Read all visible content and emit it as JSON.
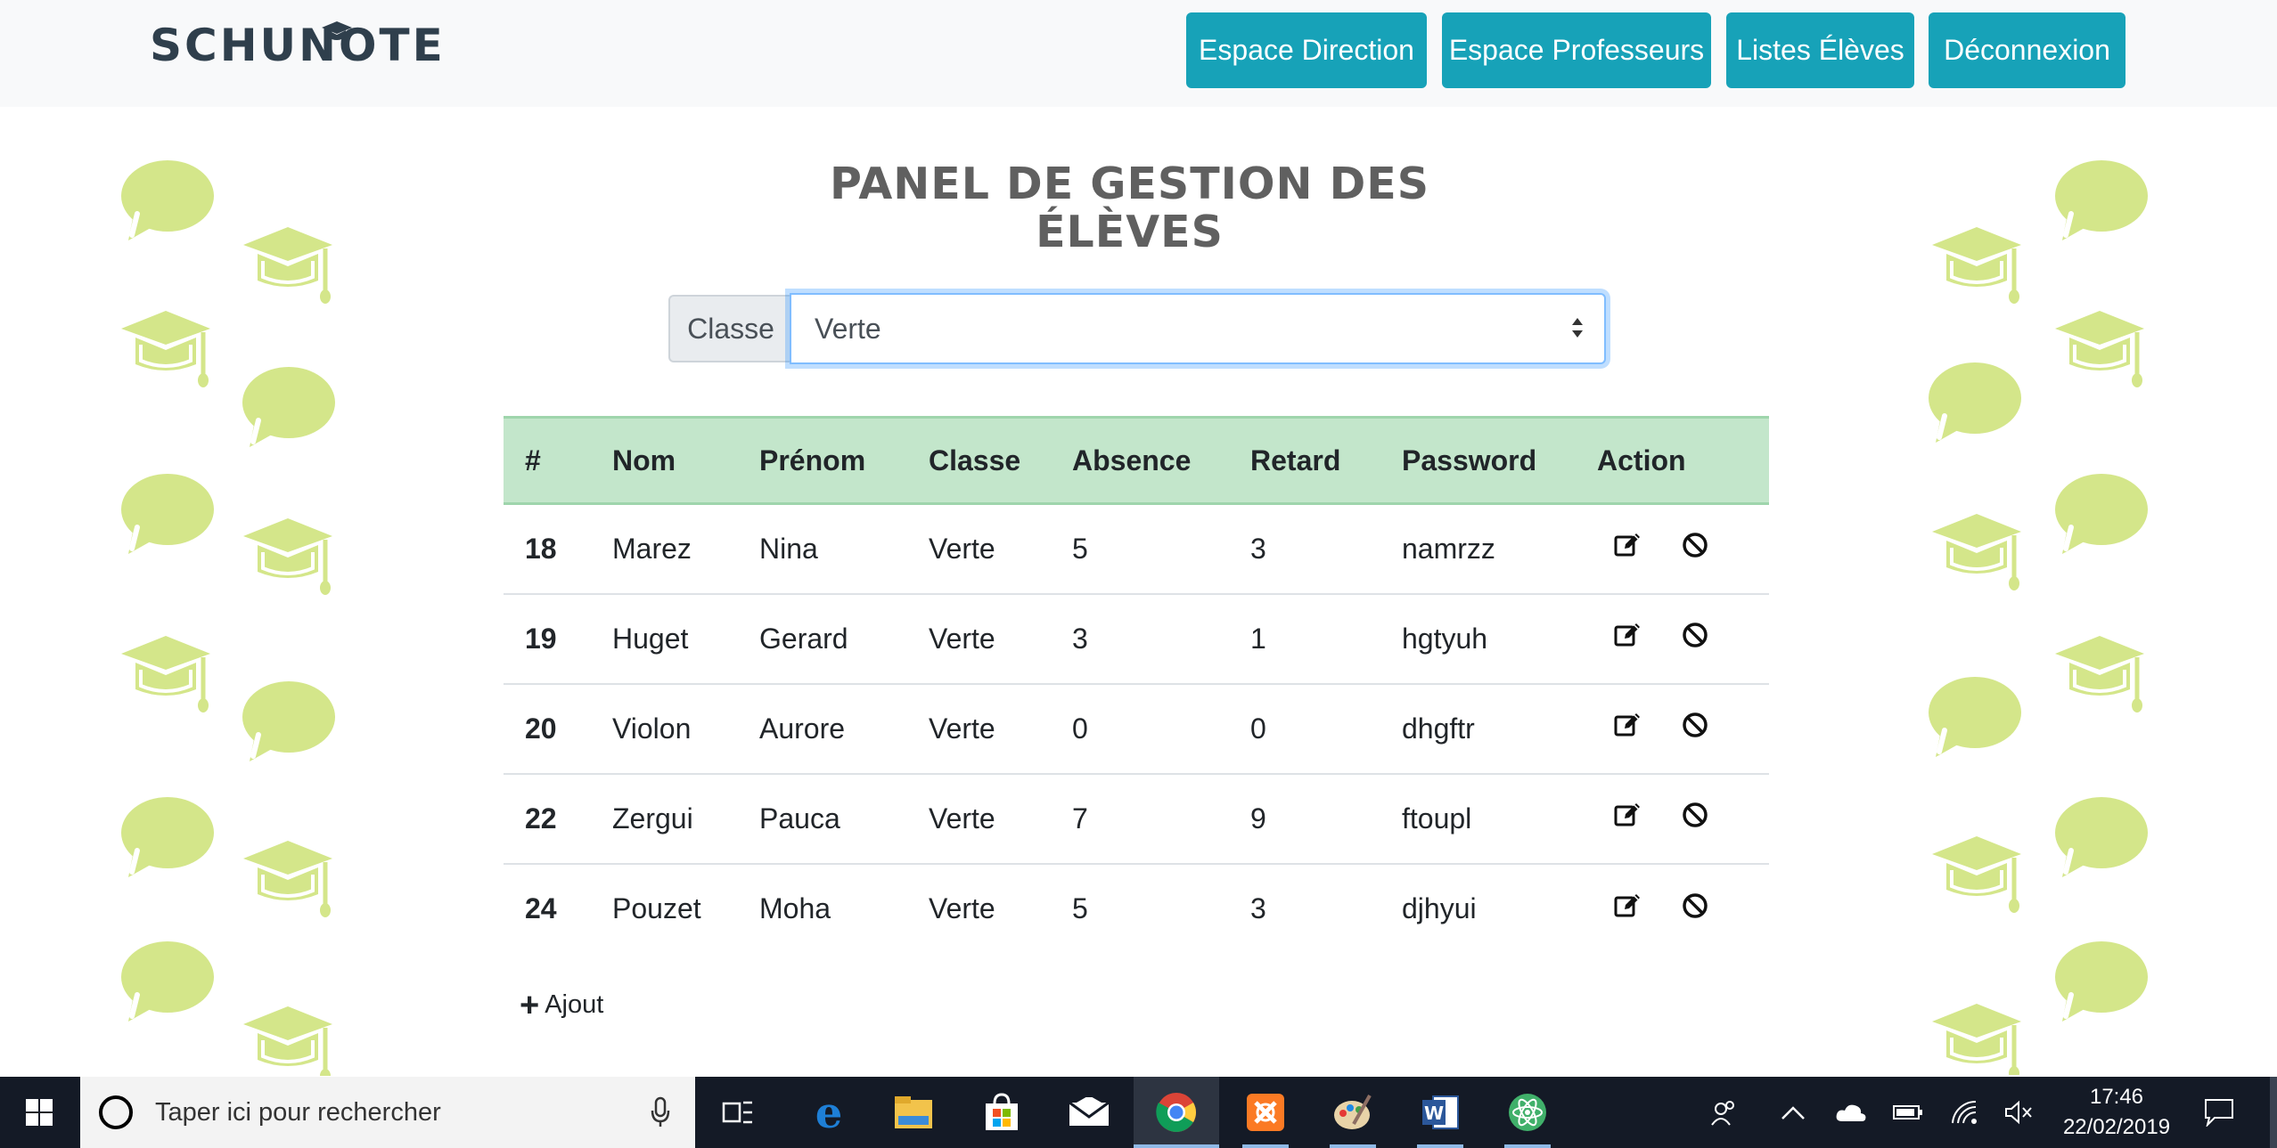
{
  "brand": {
    "name": "SCHUNOTE"
  },
  "nav": {
    "buttons": [
      {
        "label": "Espace Direction"
      },
      {
        "label": "Espace Professeurs"
      },
      {
        "label": "Listes Élèves"
      },
      {
        "label": "Déconnexion"
      }
    ]
  },
  "page": {
    "title_line1": "PANEL DE GESTION DES",
    "title_line2": "ÉLÈVES"
  },
  "class_filter": {
    "label": "Classe",
    "selected": "Verte"
  },
  "table": {
    "headers": [
      "#",
      "Nom",
      "Prénom",
      "Classe",
      "Absence",
      "Retard",
      "Password",
      "Action"
    ],
    "rows": [
      {
        "id": "18",
        "nom": "Marez",
        "prenom": "Nina",
        "classe": "Verte",
        "absence": "5",
        "retard": "3",
        "password": "namrzz"
      },
      {
        "id": "19",
        "nom": "Huget",
        "prenom": "Gerard",
        "classe": "Verte",
        "absence": "3",
        "retard": "1",
        "password": "hgtyuh"
      },
      {
        "id": "20",
        "nom": "Violon",
        "prenom": "Aurore",
        "classe": "Verte",
        "absence": "0",
        "retard": "0",
        "password": "dhgftr"
      },
      {
        "id": "22",
        "nom": "Zergui",
        "prenom": "Pauca",
        "classe": "Verte",
        "absence": "7",
        "retard": "9",
        "password": "ftoupl"
      },
      {
        "id": "24",
        "nom": "Pouzet",
        "prenom": "Moha",
        "classe": "Verte",
        "absence": "5",
        "retard": "3",
        "password": "djhyui"
      }
    ],
    "row_actions": [
      "edit-icon",
      "ban-icon"
    ]
  },
  "add_link": {
    "label": "Ajout"
  },
  "taskbar": {
    "search_placeholder": "Taper ici pour rechercher",
    "time": "17:46",
    "date": "22/02/2019",
    "apps": [
      "task-view",
      "edge",
      "file-explorer",
      "store",
      "mail",
      "chrome",
      "xampp",
      "paint",
      "word",
      "atom"
    ]
  },
  "colors": {
    "nav_button": "#17a2b8",
    "table_header": "#c3e6cb",
    "decoration": "#d4e68a",
    "brand": "#2f3f4c",
    "taskbar": "#141a26"
  }
}
